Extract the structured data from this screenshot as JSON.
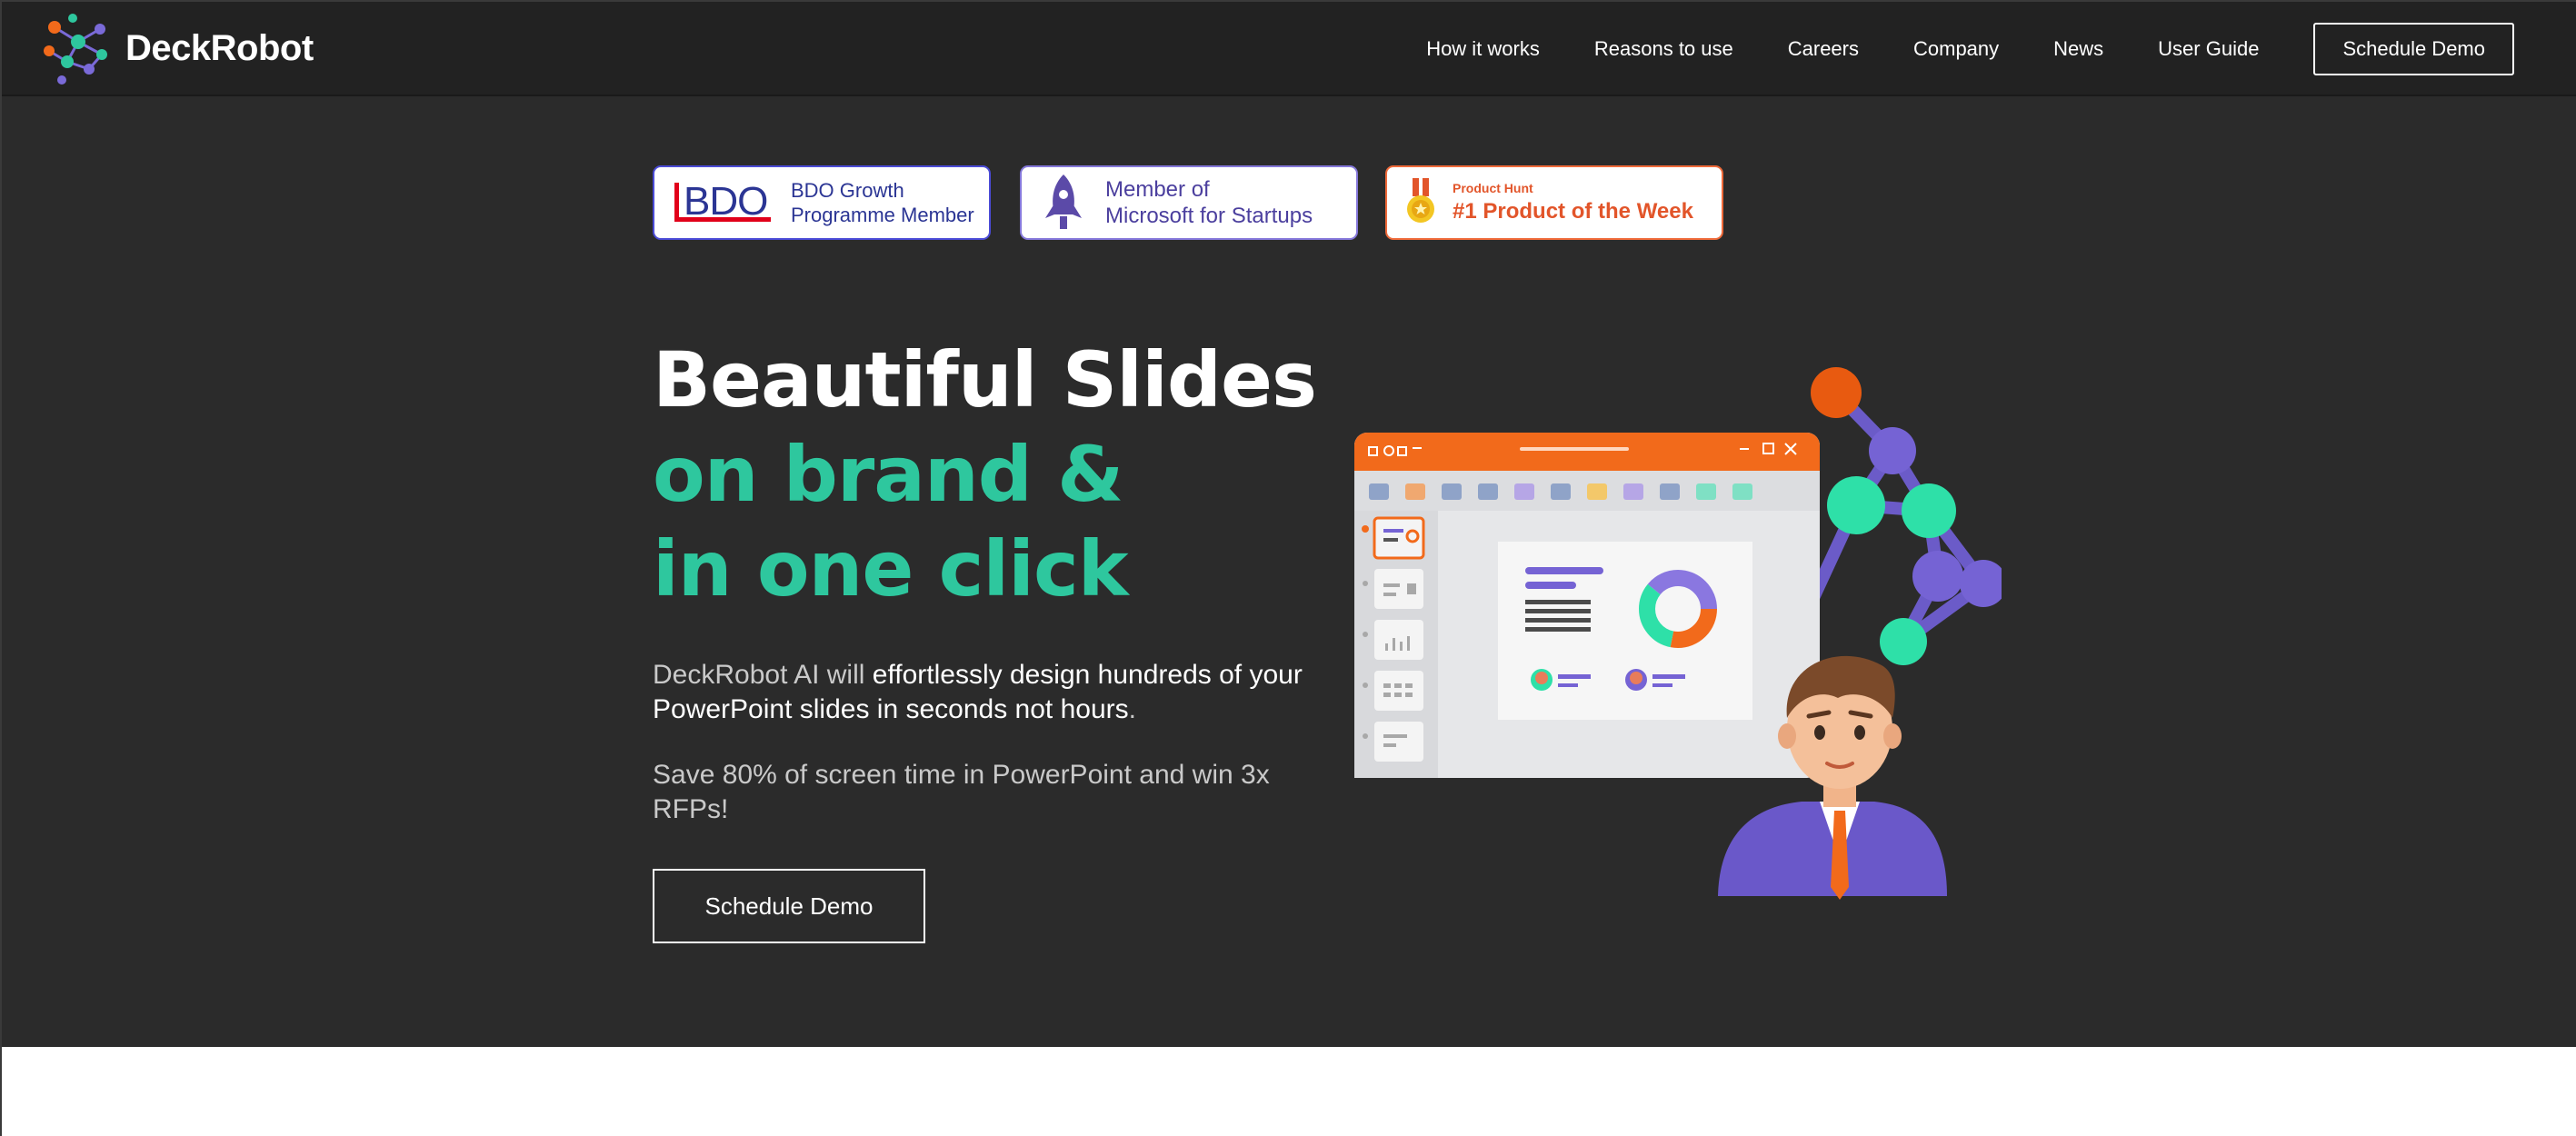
{
  "brand": {
    "name": "DeckRobot"
  },
  "nav": {
    "items": [
      {
        "label": "How it works"
      },
      {
        "label": "Reasons to use"
      },
      {
        "label": "Careers"
      },
      {
        "label": "Company"
      },
      {
        "label": "News"
      },
      {
        "label": "User Guide"
      }
    ],
    "demo_button": "Schedule Demo"
  },
  "badges": {
    "bdo": {
      "logo_text": "BDO",
      "line1": "BDO Growth",
      "line2": "Programme Member"
    },
    "microsoft": {
      "line1": "Member of",
      "line2": "Microsoft for Startups"
    },
    "producthunt": {
      "small": "Product Hunt",
      "big": "#1 Product of the Week"
    }
  },
  "hero": {
    "headline_line1": "Beautiful Slides",
    "headline_line2": "on brand &",
    "headline_line3": "in one click",
    "desc_part1": "DeckRobot AI will ",
    "desc_part2": "effortlessly design hundreds of your PowerPoint slides in seconds not hours",
    "desc_part3": ".",
    "desc2": "Save 80% of screen time in PowerPoint and win 3x RFPs!",
    "cta_label": "Schedule Demo"
  },
  "colors": {
    "header_bg": "#222222",
    "hero_bg": "#2b2b2b",
    "accent_green": "#2ec79e",
    "accent_orange": "#f26a1b",
    "accent_purple": "#7563d4"
  }
}
